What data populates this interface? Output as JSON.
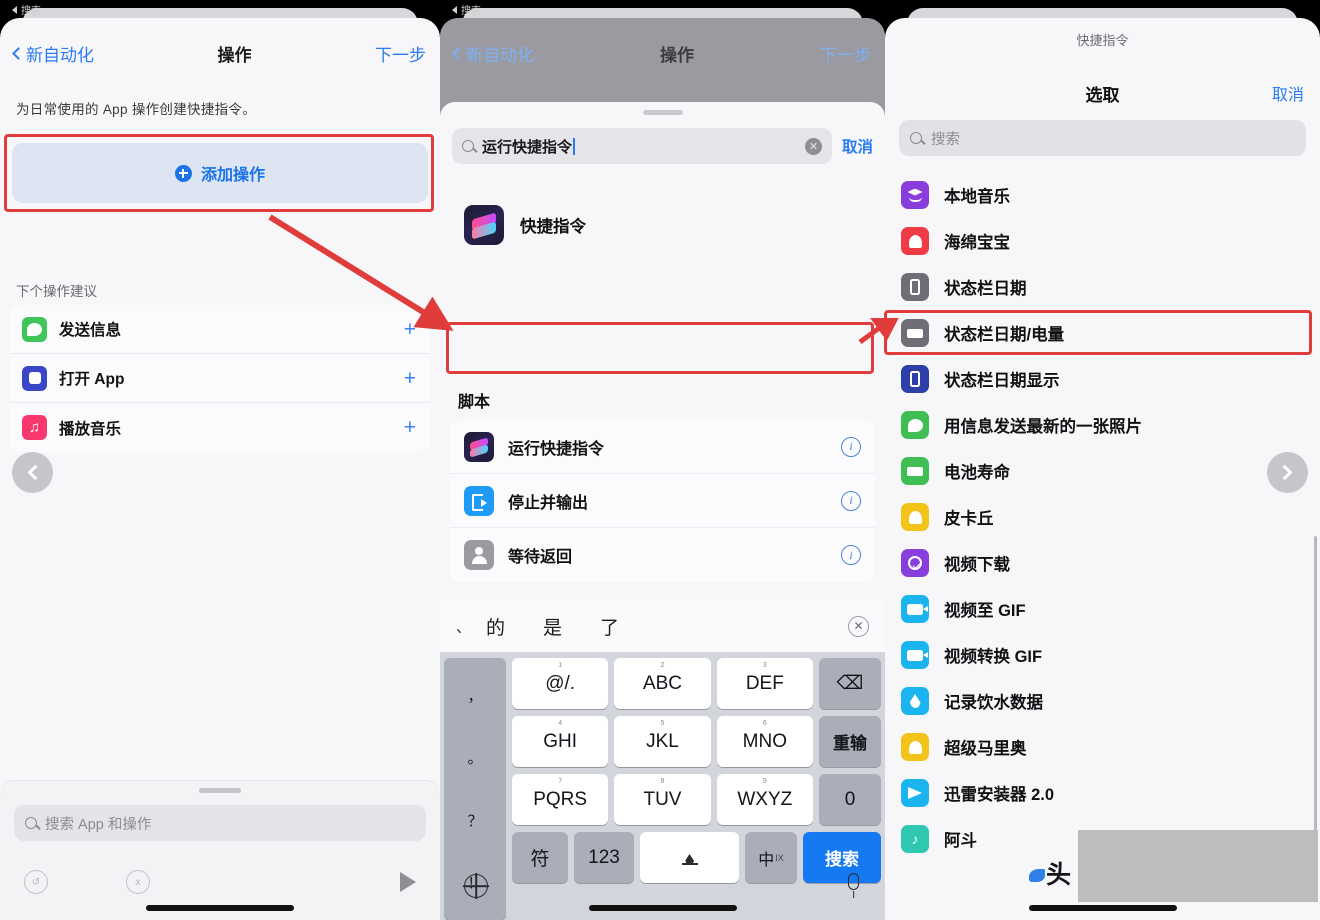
{
  "status_bar": {
    "back_label": "搜索"
  },
  "panel1": {
    "nav": {
      "back": "新自动化",
      "title": "操作",
      "next": "下一步"
    },
    "description": "为日常使用的 App 操作创建快捷指令。",
    "add_action_label": "添加操作",
    "suggestions_header": "下个操作建议",
    "suggestions": [
      {
        "label": "发送信息",
        "icon": "messages-icon",
        "color": "#3fc55a",
        "glyph": "g-msg",
        "add": "+"
      },
      {
        "label": "打开 App",
        "icon": "open-app-icon",
        "color": "#3a46c8",
        "glyph": "g-appsq",
        "add": "+"
      },
      {
        "label": "播放音乐",
        "icon": "music-icon",
        "color": "#f8386c",
        "glyph": "g-music",
        "add": "+"
      }
    ],
    "bottom_search_placeholder": "搜索 App 和操作",
    "nav_prev_icon": "chevron-left-icon",
    "play_icon": "play-icon"
  },
  "panel2": {
    "nav": {
      "back": "新自动化",
      "title": "操作",
      "next": "下一步"
    },
    "search_value": "运行快捷指令",
    "cancel": "取消",
    "app_result": {
      "name": "快捷指令",
      "icon": "shortcuts-app-icon"
    },
    "scripts_header": "脚本",
    "scripts": [
      {
        "label": "运行快捷指令",
        "icon": "shortcuts-icon",
        "info": "i",
        "highlighted": true
      },
      {
        "label": "停止并输出",
        "icon": "stop-output-icon",
        "color": "#1d9bf5",
        "glyph": "g-exit",
        "info": "i"
      },
      {
        "label": "等待返回",
        "icon": "wait-return-icon",
        "color": "#9a9aa0",
        "glyph": "g-person",
        "info": "i"
      }
    ],
    "keyboard": {
      "candidates": [
        "的",
        "是",
        "了"
      ],
      "leading_dot": "、",
      "close_icon": "close-circle-icon",
      "left_column": [
        "，",
        "。",
        "？",
        "！"
      ],
      "rows": [
        [
          {
            "main": "@/.",
            "sup": "1"
          },
          {
            "main": "ABC",
            "sup": "2"
          },
          {
            "main": "DEF",
            "sup": "3"
          },
          {
            "main": "delete-icon",
            "type": "gray"
          }
        ],
        [
          {
            "main": "GHI",
            "sup": "4"
          },
          {
            "main": "JKL",
            "sup": "5"
          },
          {
            "main": "MNO",
            "sup": "6"
          },
          {
            "main": "重输",
            "type": "gray"
          }
        ],
        [
          {
            "main": "PQRS",
            "sup": "7"
          },
          {
            "main": "TUV",
            "sup": "8"
          },
          {
            "main": "WXYZ",
            "sup": "9"
          },
          {
            "main": "0",
            "type": "gray"
          }
        ],
        [
          {
            "main": "符",
            "type": "gray"
          },
          {
            "main": "123",
            "type": "gray"
          },
          {
            "main": "space-key",
            "type": "white"
          },
          {
            "main": "中",
            "sub": "IX",
            "type": "gray"
          },
          {
            "main": "搜索",
            "type": "blue"
          }
        ]
      ],
      "globe_icon": "globe-icon",
      "mic_icon": "microphone-icon"
    }
  },
  "panel3": {
    "app_title": "快捷指令",
    "nav": {
      "title": "选取",
      "cancel": "取消"
    },
    "search_placeholder": "搜索",
    "items": [
      {
        "label": "本地音乐",
        "color": "#8a3ddd",
        "glyph": "g-layers"
      },
      {
        "label": "海绵宝宝",
        "color": "#ef3b46",
        "glyph": "g-bell"
      },
      {
        "label": "状态栏日期",
        "color": "#6e6e76",
        "glyph": "g-phone"
      },
      {
        "label": "状态栏日期/电量",
        "color": "#6e6e76",
        "glyph": "g-batt",
        "highlighted": true
      },
      {
        "label": "状态栏日期显示",
        "color": "#2e3fa8",
        "glyph": "g-phone"
      },
      {
        "label": "用信息发送最新的一张照片",
        "color": "#3fbe54",
        "glyph": "g-chat"
      },
      {
        "label": "电池寿命",
        "color": "#3fbe54",
        "glyph": "g-batt"
      },
      {
        "label": "皮卡丘",
        "color": "#f2c318",
        "glyph": "g-bell"
      },
      {
        "label": "视频下载",
        "color": "#8a3ddd",
        "glyph": "g-check"
      },
      {
        "label": "视频至 GIF",
        "color": "#1ab4ef",
        "glyph": "g-cam"
      },
      {
        "label": "视频转换 GIF",
        "color": "#1ab4ef",
        "glyph": "g-cam"
      },
      {
        "label": "记录饮水数据",
        "color": "#1ab4ef",
        "glyph": "g-drop"
      },
      {
        "label": "超级马里奥",
        "color": "#f2c318",
        "glyph": "g-bell"
      },
      {
        "label": "迅雷安装器 2.0",
        "color": "#1ab4ef",
        "glyph": "g-plane"
      },
      {
        "label": "阿斗",
        "color": "#2ec7b0",
        "glyph": "g-note"
      }
    ],
    "nav_next_icon": "chevron-right-icon",
    "watermark": "头"
  },
  "annotations": {
    "highlight_color": "#e03c3c",
    "arrow_color": "#e03c3c",
    "arrows": [
      {
        "name": "arrow-add-action-to-run-shortcut"
      },
      {
        "name": "arrow-run-shortcut-to-status-bar-item"
      }
    ]
  }
}
